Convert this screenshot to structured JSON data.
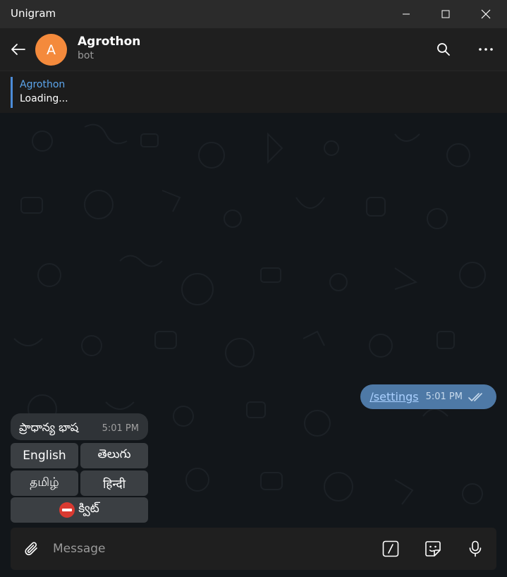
{
  "window": {
    "title": "Unigram",
    "minimize_icon": "minimize-icon",
    "maximize_icon": "maximize-icon",
    "close_icon": "close-icon"
  },
  "header": {
    "back_icon": "arrow-left-icon",
    "avatar_letter": "A",
    "avatar_color": "#f48a3c",
    "name": "Agrothon",
    "status": "bot",
    "search_icon": "search-icon",
    "more_icon": "more-horizontal-icon"
  },
  "pinned": {
    "title": "Agrothon",
    "text": "Loading..."
  },
  "messages": {
    "outgoing": {
      "text": "/settings",
      "time": "5:01 PM",
      "status_icon": "double-check-icon"
    },
    "incoming": {
      "text": "ప్రాధాన్య భాష",
      "time": "5:01 PM"
    }
  },
  "keyboard": {
    "english": "English",
    "telugu": "తెలుగు",
    "tamil": "தமிழ்",
    "hindi": "हिन्दी",
    "quit_icon": "stop-sign-icon",
    "quit": "క్విట్"
  },
  "composer": {
    "attach_icon": "paperclip-icon",
    "placeholder": "Message",
    "commands_icon": "slash-command-icon",
    "sticker_icon": "sticker-icon",
    "mic_icon": "microphone-icon"
  },
  "colors": {
    "accent": "#5ca5ec",
    "outgoing_bubble": "#4e79a6",
    "incoming_bubble": "#2f3337",
    "chat_background": "#12161a"
  }
}
